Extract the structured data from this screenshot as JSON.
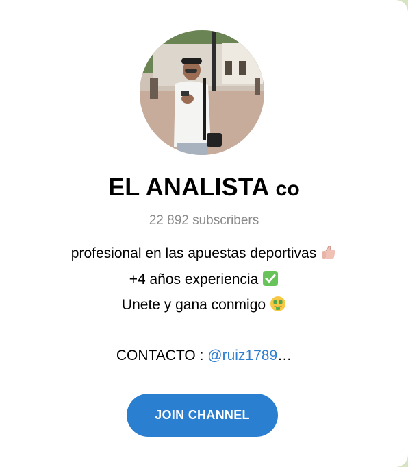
{
  "channel": {
    "name": "EL ANALISTA",
    "name_suffix": "co",
    "subscribers": "22 892 subscribers"
  },
  "description": {
    "line1": "profesional en las apuestas deportivas",
    "line2": "+4 años experiencia",
    "line3": "Unete y gana conmigo",
    "contact_label": "CONTACTO :",
    "contact_handle": "@ruiz1789",
    "contact_ellipsis": "…"
  },
  "icons": {
    "line1": "thumbs-up-icon",
    "line2": "check-mark-button-icon",
    "line3": "money-mouth-face-icon"
  },
  "actions": {
    "join_label": "JOIN CHANNEL"
  },
  "colors": {
    "button": "#2b7fd1",
    "link": "#2e7fd0",
    "subtitle": "#8a8a8a"
  }
}
